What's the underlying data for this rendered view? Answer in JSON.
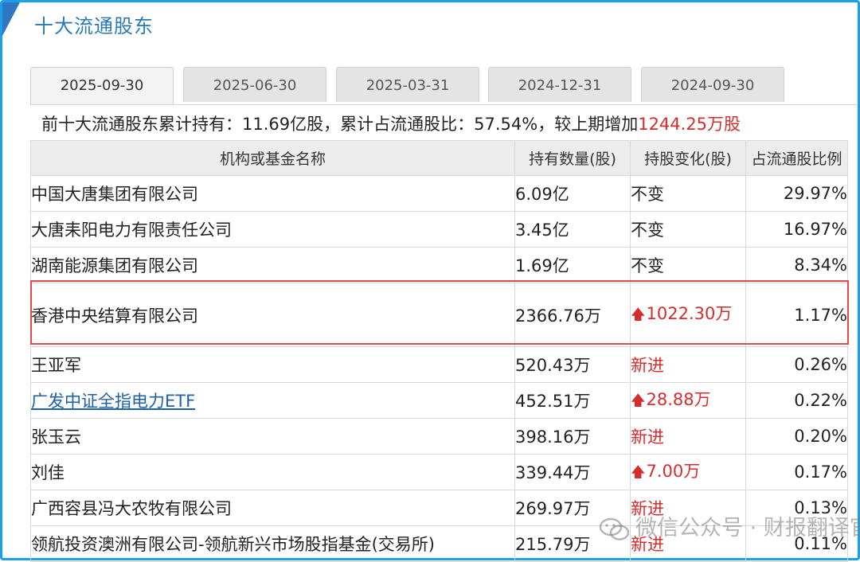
{
  "title": "十大流通股东",
  "tabs": [
    {
      "label": "2025-09-30",
      "active": true
    },
    {
      "label": "2025-06-30",
      "active": false
    },
    {
      "label": "2025-03-31",
      "active": false
    },
    {
      "label": "2024-12-31",
      "active": false
    },
    {
      "label": "2024-09-30",
      "active": false
    }
  ],
  "summary": {
    "text": "前十大流通股东累计持有：11.69亿股，累计占流通股比：57.54%，较上期增加",
    "highlight": "1244.25万股"
  },
  "table": {
    "headers": [
      "机构或基金名称",
      "持有数量(股)",
      "持股变化(股)",
      "占流通股比例"
    ],
    "rows": [
      {
        "name": "中国大唐集团有限公司",
        "qty": "6.09亿",
        "change": "不变",
        "pct": "29.97%"
      },
      {
        "name": "大唐耒阳电力有限责任公司",
        "qty": "3.45亿",
        "change": "不变",
        "pct": "16.97%"
      },
      {
        "name": "湖南能源集团有限公司",
        "qty": "1.69亿",
        "change": "不变",
        "pct": "8.34%"
      },
      {
        "name": "香港中央结算有限公司",
        "qty": "2366.76万",
        "change": "1022.30万",
        "pct": "1.17%"
      },
      {
        "name": "王亚军",
        "qty": "520.43万",
        "change": "新进",
        "pct": "0.26%"
      },
      {
        "name": "广发中证全指电力ETF",
        "qty": "452.51万",
        "change": "28.88万",
        "pct": "0.22%"
      },
      {
        "name": "张玉云",
        "qty": "398.16万",
        "change": "新进",
        "pct": "0.20%"
      },
      {
        "name": "刘佳",
        "qty": "339.44万",
        "change": "7.00万",
        "pct": "0.17%"
      },
      {
        "name": "广西容县冯大农牧有限公司",
        "qty": "269.97万",
        "change": "新进",
        "pct": "0.13%"
      },
      {
        "name": "领航投资澳洲有限公司-领航新兴市场股指基金(交易所)",
        "qty": "215.79万",
        "change": "新进",
        "pct": "0.11%"
      }
    ]
  },
  "watermark": "微信公众号 · 财报翻译官",
  "colors": {
    "accent": "#2a7ab8",
    "frame": "#1aa0e8",
    "increase": "#d62c2c",
    "highlight_box": "#e04b4b"
  },
  "icons": {
    "increase": "up-arrow-icon",
    "watermark_logo": "wechat-icon"
  }
}
